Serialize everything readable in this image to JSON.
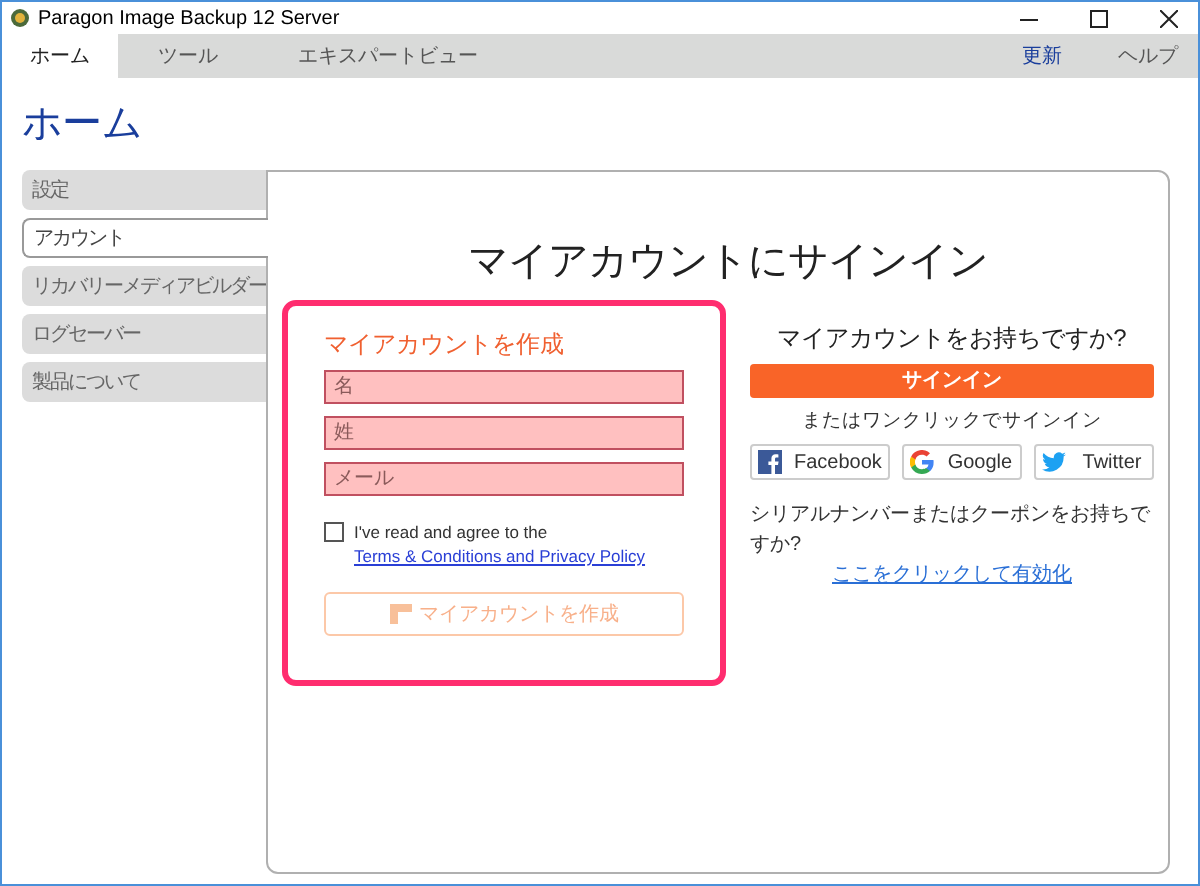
{
  "window": {
    "title": "Paragon Image Backup 12 Server"
  },
  "tabs": [
    {
      "label": "ホーム",
      "selected": true
    },
    {
      "label": "ツール",
      "selected": false
    },
    {
      "label": "エキスパートビュー",
      "selected": false
    }
  ],
  "menu_right": [
    "更新",
    "ヘルプ"
  ],
  "page_title": "ホーム",
  "sidebar": {
    "items": [
      {
        "label": "設定",
        "selected": false
      },
      {
        "label": "アカウント",
        "selected": true
      },
      {
        "label": "リカバリーメディアビルダー",
        "selected": false
      },
      {
        "label": "ログセーバー",
        "selected": false
      },
      {
        "label": "製品について",
        "selected": false
      }
    ]
  },
  "panel": {
    "title": "マイアカウントにサインイン",
    "create": {
      "heading": "マイアカウントを作成",
      "fields": [
        {
          "placeholder": "名"
        },
        {
          "placeholder": "姓"
        },
        {
          "placeholder": "メール"
        }
      ],
      "agree": {
        "checked": false,
        "text": "I've read and agree to the ",
        "link": "Terms & Conditions and Privacy Policy"
      },
      "button": {
        "label": "マイアカウントを作成",
        "disabled": true
      }
    },
    "signin": {
      "heading": "マイアカウントをお持ちですか?",
      "button": "サインイン",
      "or_text": "またはワンクリックでサインイン",
      "social": [
        {
          "kind": "facebook",
          "label": "Facebook"
        },
        {
          "kind": "google",
          "label": "Google"
        },
        {
          "kind": "twitter",
          "label": "Twitter"
        }
      ],
      "serial_text": "シリアルナンバーまたはクーポンをお持ちですか?",
      "serial_link": "ここをクリックして有効化"
    }
  }
}
